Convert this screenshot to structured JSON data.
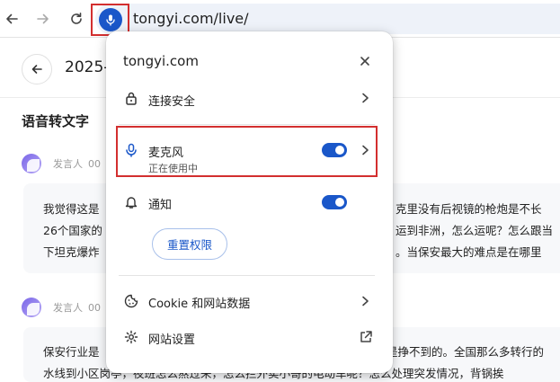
{
  "browser": {
    "url": "tongyi.com/live/"
  },
  "page": {
    "title": "2025-",
    "section_title": "语音转文字",
    "speakers": [
      {
        "label": "发言人",
        "time": "00"
      },
      {
        "label": "发言人",
        "time": "00"
      }
    ],
    "paragraph1": [
      "我觉得这是",
      "26个国家的",
      "下坦克爆炸"
    ],
    "paragraph1_right": [
      "克里没有后视镜的枪炮是不长",
      "运到非洲，怎么运呢？怎么跟当",
      "。当保安最大的难点是在哪里"
    ],
    "paragraph2": [
      "保安行业是",
      "水线到小区岗亭，夜班怎么熬过来，怎么拦外卖小哥的电动车呢？怎么处理突发情况，背锅挨"
    ],
    "paragraph2_right": [
      "是挣不到的。全国那么多转行的"
    ]
  },
  "popup": {
    "site": "tongyi.com",
    "connection_label": "连接安全",
    "microphone_label": "麦克风",
    "microphone_status": "正在使用中",
    "microphone_enabled": true,
    "notifications_label": "通知",
    "notifications_enabled": true,
    "reset_button": "重置权限",
    "cookies_label": "Cookie 和网站数据",
    "site_settings_label": "网站设置"
  },
  "colors": {
    "accent": "#1a57c9",
    "highlight_border": "#d32f2f"
  }
}
